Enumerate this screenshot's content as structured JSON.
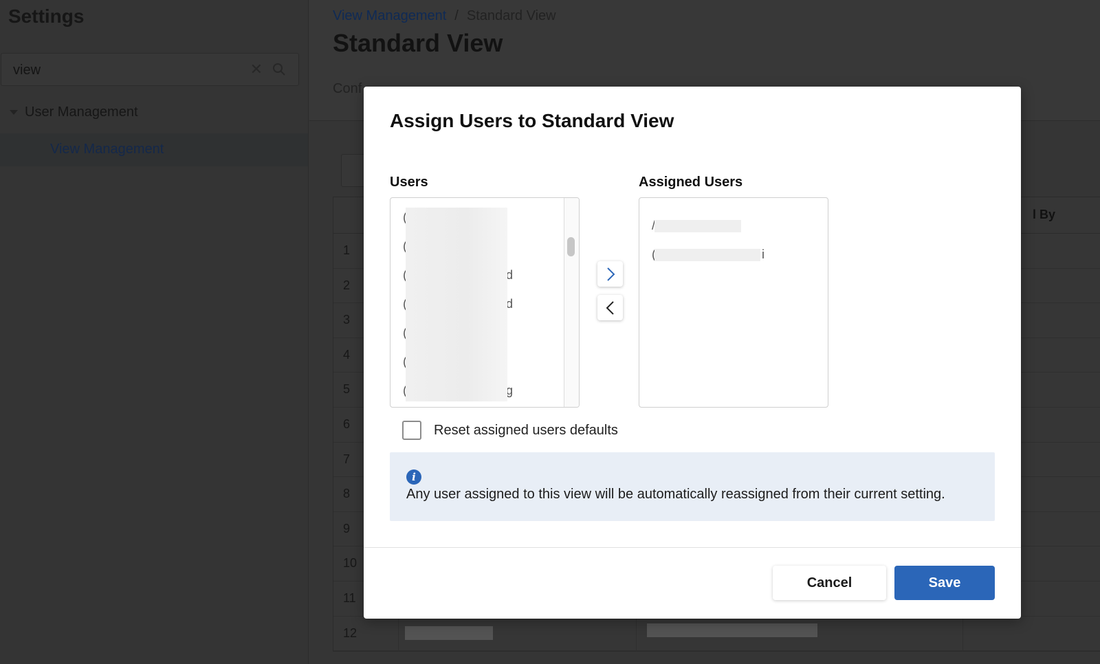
{
  "sidebar": {
    "title": "Settings",
    "search": {
      "value": "view",
      "clear_icon": "close-icon",
      "search_icon": "search-icon"
    },
    "tree": {
      "parent_label": "User Management",
      "child_label": "View Management"
    }
  },
  "main": {
    "breadcrumb": {
      "link": "View Management",
      "separator": "/",
      "current": "Standard View"
    },
    "title": "Standard View",
    "tabs": [
      "Conf",
      "",
      ""
    ],
    "table": {
      "header_last": "l By",
      "row_numbers": [
        "1",
        "2",
        "3",
        "4",
        "5",
        "6",
        "7",
        "8",
        "9",
        "10",
        "11",
        "12"
      ]
    }
  },
  "modal": {
    "title": "Assign Users to Standard View",
    "users_label": "Users",
    "assigned_label": "Assigned Users",
    "users_items": [
      {
        "stub": "(",
        "tail": ""
      },
      {
        "stub": "(",
        "tail": ""
      },
      {
        "stub": "(",
        "tail": "d"
      },
      {
        "stub": "(",
        "tail": "d"
      },
      {
        "stub": "(",
        "tail": ""
      },
      {
        "stub": "(",
        "tail": ""
      },
      {
        "stub": "(",
        "tail": "g"
      }
    ],
    "assigned_items": [
      {
        "stub": "/",
        "tail": ""
      },
      {
        "stub": "(",
        "tail": "i"
      }
    ],
    "move_right_icon": "chevron-right-icon",
    "move_left_icon": "chevron-left-icon",
    "checkbox_label": "Reset assigned users defaults",
    "checkbox_checked": false,
    "info_icon": "info-icon",
    "info_text": "Any user assigned to this view will be automatically reassigned from their current setting.",
    "cancel_label": "Cancel",
    "save_label": "Save",
    "accent_color": "#2b66b8"
  }
}
